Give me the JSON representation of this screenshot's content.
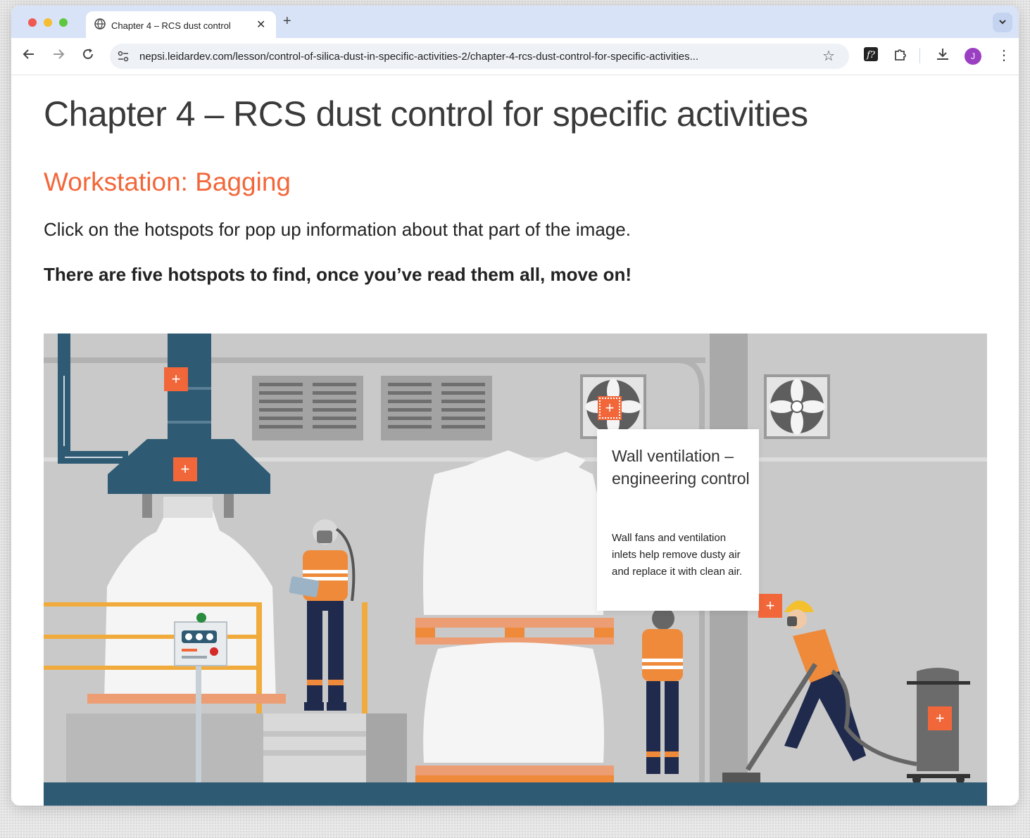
{
  "browser": {
    "tab_title": "Chapter 4 – RCS dust control",
    "url": "nepsi.leidardev.com/lesson/control-of-silica-dust-in-specific-activities-2/chapter-4-rcs-dust-control-for-specific-activities...",
    "avatar_letter": "J",
    "new_tab_symbol": "+",
    "close_symbol": "✕"
  },
  "page": {
    "title": "Chapter 4 – RCS dust control for specific activities",
    "subtitle": "Workstation: Bagging",
    "instruction": "Click on the hotspots for pop up information about that part of the image.",
    "instruction_bold": "There are five hotspots to find, once you’ve read them all, move on!"
  },
  "hotspot_symbol": "+",
  "popup": {
    "title": "Wall ventilation – engineering control",
    "body": "Wall fans and ventilation inlets help remove dusty air and replace it with clean air."
  },
  "colors": {
    "accent": "#f2673a",
    "duct": "#2e5a74",
    "navy": "#1f2a4d",
    "orange": "#ef8a3a"
  }
}
